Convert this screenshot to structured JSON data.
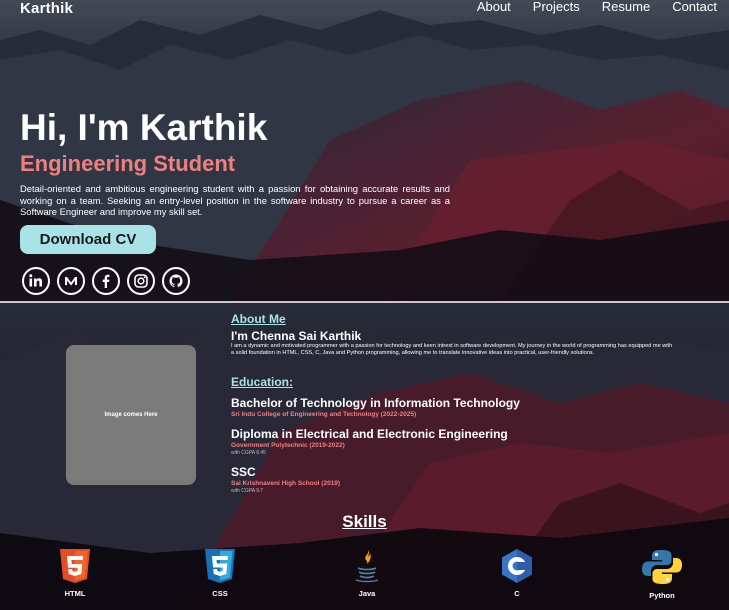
{
  "nav": {
    "brand": "Karthik",
    "links": [
      "About",
      "Projects",
      "Resume",
      "Contact"
    ]
  },
  "hero": {
    "title": "Hi, I'm Karthik",
    "subtitle": "Engineering Student",
    "description": "Detail-oriented and ambitious engineering student with a passion for obtaining accurate results and working on a team. Seeking an entry-level position in the software industry to pursue a career as a Software Engineer and improve my skill set.",
    "cv_button": "Download CV",
    "socials": [
      "linkedin-icon",
      "medium-icon",
      "facebook-icon",
      "instagram-icon",
      "github-icon"
    ]
  },
  "about": {
    "photo_placeholder": "Image comes Here",
    "heading": "About Me",
    "name": "I'm Chenna Sai Karthik",
    "bio": "I am a dynamic and motivated programmer with a passion for technology and keen intrest in software development. My journey in the world of programming has equipped me with a solid foundation in HTML, CSS, C, Java and Python programming, allowing me to translate innovative ideas into practical, user-friendly solutions.",
    "education_heading": "Education:",
    "education": [
      {
        "title": "Bachelor of Technology in Information Technology",
        "school": "Sri Indu College of Engineering and Technology (2022-2025)",
        "grade": ""
      },
      {
        "title": "Diploma in Electrical and Electronic Engineering",
        "school": "Government Polytechnic (2019-2022)",
        "grade": "with CGPA 8.45"
      },
      {
        "title": "SSC",
        "school": "Sai Krishnaveni High School (2019)",
        "grade": "with CGPA 9.7"
      }
    ]
  },
  "skills": {
    "heading": "Skills",
    "items": [
      {
        "label": "HTML",
        "icon": "html5-icon",
        "color": "#e44d26"
      },
      {
        "label": "CSS",
        "icon": "css3-icon",
        "color": "#2965f1"
      },
      {
        "label": "Java",
        "icon": "java-icon",
        "color": "#f89820"
      },
      {
        "label": "C",
        "icon": "c-language-icon",
        "color": "#3a74c8"
      },
      {
        "label": "Python",
        "icon": "python-icon",
        "color": "#ffd43b"
      }
    ]
  }
}
